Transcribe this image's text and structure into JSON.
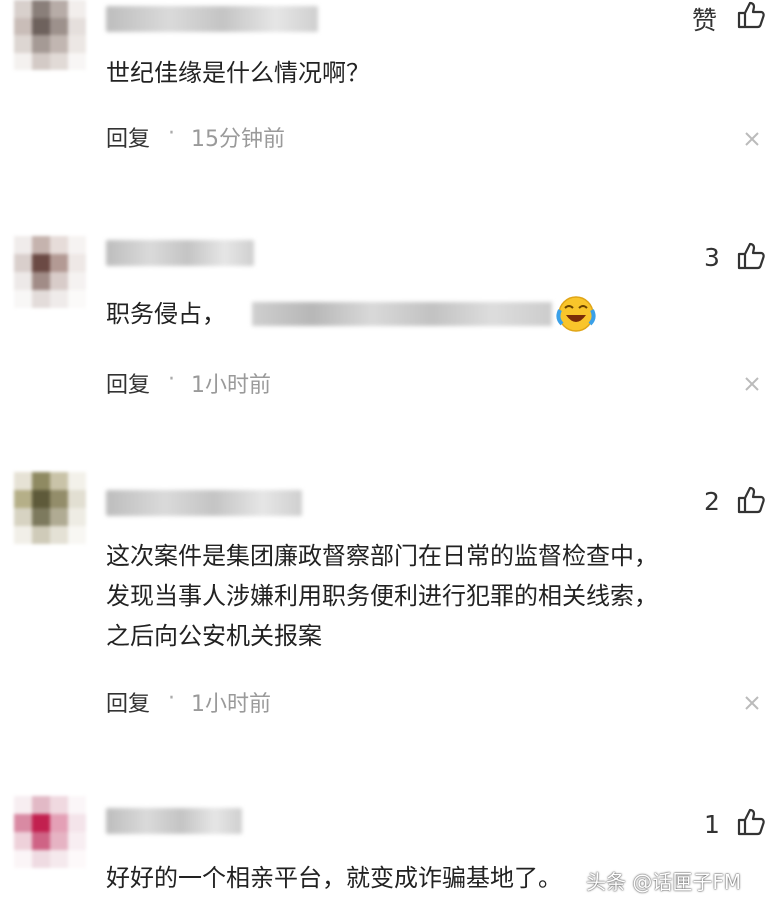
{
  "comments": [
    {
      "avatar_colors": [
        "#d8d0cc",
        "#8a7f7a",
        "#b7aca7",
        "#f2eeec",
        "#c9bdb8",
        "#6e625d",
        "#9d918c",
        "#e5dfdc",
        "#ddd6d2",
        "#a59a95",
        "#c1b6b1",
        "#ece7e4",
        "#f4f1ef",
        "#d3cac6",
        "#e1dad6",
        "#f8f6f5"
      ],
      "like_label": "赞",
      "text_lines": [
        "世纪佳缘是什么情况啊？"
      ],
      "reply": "回复",
      "time": "15分钟前"
    },
    {
      "avatar_colors": [
        "#f0eceb",
        "#c5b3ae",
        "#e6dcd9",
        "#f6f3f2",
        "#d9cfcc",
        "#6b4a44",
        "#b39a94",
        "#eee8e6",
        "#ede9e8",
        "#a18c87",
        "#d8ccc9",
        "#f5f2f1",
        "#f8f7f6",
        "#e3dcda",
        "#efebea",
        "#fbfaf9"
      ],
      "like_count": "3",
      "text_lines": [
        "职务侵占，"
      ],
      "reply": "回复",
      "time": "1小时前"
    },
    {
      "avatar_colors": [
        "#e6e2d5",
        "#8f8a62",
        "#c9c3a8",
        "#f3f1ea",
        "#b5af88",
        "#5e5a3a",
        "#938d6a",
        "#e2dfd2",
        "#d7d3c2",
        "#7d7a5e",
        "#b0ab93",
        "#eeece4",
        "#f1efe8",
        "#cfcbb9",
        "#e4e1d5",
        "#f8f7f3"
      ],
      "like_count": "2",
      "text_lines": [
        "这次案件是集团廉政督察部门在日常的监督检查中，",
        "发现当事人涉嫌利用职务便利进行犯罪的相关线索，",
        "之后向公安机关报案"
      ],
      "reply": "回复",
      "time": "1小时前"
    },
    {
      "avatar_colors": [
        "#f7eef1",
        "#e2b9c6",
        "#f0d9e0",
        "#fbf6f8",
        "#d98aa3",
        "#c2204f",
        "#e4a0b6",
        "#f4e4ea",
        "#eed1da",
        "#cf6385",
        "#e6b3c3",
        "#f8eef2",
        "#fbf5f7",
        "#efdbe2",
        "#f5e9ed",
        "#fdf9fa"
      ],
      "like_count": "1",
      "text_lines": [
        "好好的一个相亲平台，就变成诈骗基地了。"
      ],
      "reply": "回复",
      "time": ""
    }
  ],
  "reply_separator": "·",
  "watermark": "头条 @话匣子FM"
}
